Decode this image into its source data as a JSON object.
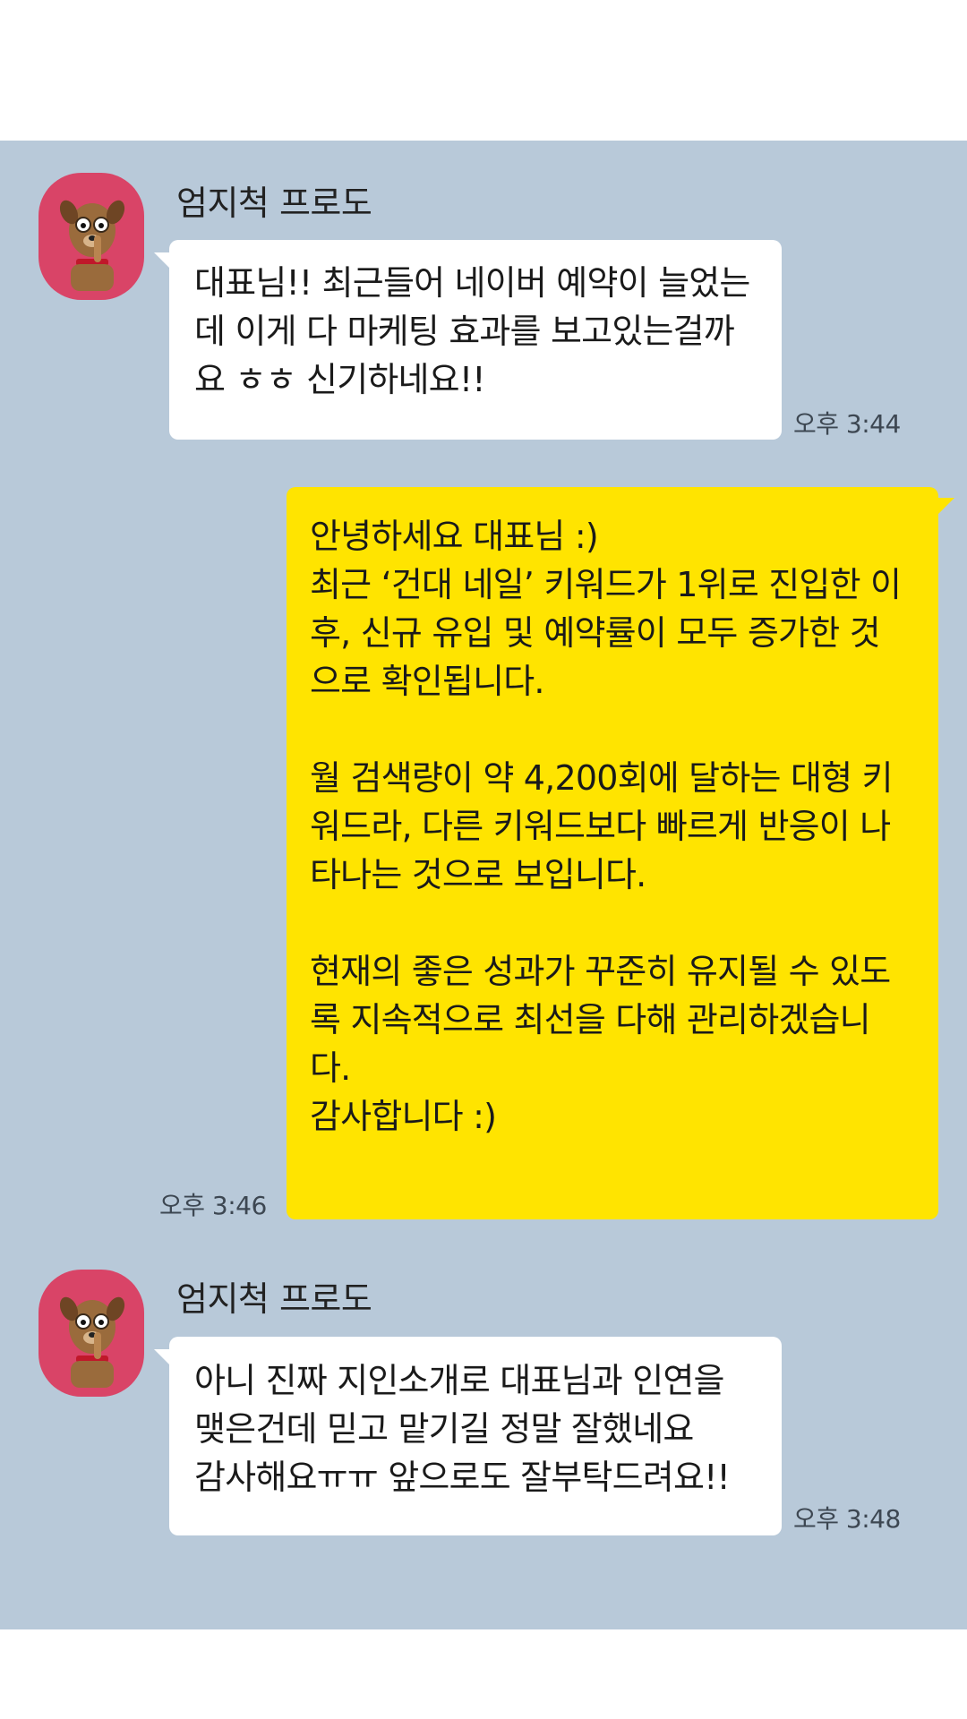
{
  "colors": {
    "chat_background": "#b8c9d9",
    "incoming_bubble": "#ffffff",
    "outgoing_bubble": "#ffe400",
    "avatar_background": "#d94467"
  },
  "messages": [
    {
      "direction": "incoming",
      "sender": "엄지척 프로도",
      "avatar_icon": "dog-character-avatar-icon",
      "lines": [
        "대표님!! 최근들어 네이버 예약이 늘었는",
        "데 이게 다 마케팅 효과를 보고있는걸까",
        "요 ㅎㅎ 신기하네요!!"
      ],
      "time": "오후 3:44"
    },
    {
      "direction": "outgoing",
      "lines": [
        "안녕하세요 대표님 :)",
        "최근 ‘건대 네일’ 키워드가 1위로 진입한 이",
        "후, 신규 유입 및 예약률이 모두 증가한 것",
        "으로 확인됩니다.",
        "",
        "월 검색량이 약 4,200회에 달하는 대형 키",
        "워드라, 다른 키워드보다 빠르게 반응이 나",
        "타나는 것으로 보입니다.",
        "",
        "현재의 좋은 성과가 꾸준히 유지될 수 있도",
        "록 지속적으로 최선을 다해 관리하겠습니",
        "다.",
        "감사합니다 :)"
      ],
      "time": "오후 3:46"
    },
    {
      "direction": "incoming",
      "sender": "엄지척 프로도",
      "avatar_icon": "dog-character-avatar-icon",
      "lines": [
        "아니 진짜 지인소개로 대표님과 인연을",
        "맺은건데 믿고 맡기길 정말 잘했네요",
        "감사해요ㅠㅠ 앞으로도 잘부탁드려요!!"
      ],
      "time": "오후 3:48"
    }
  ]
}
